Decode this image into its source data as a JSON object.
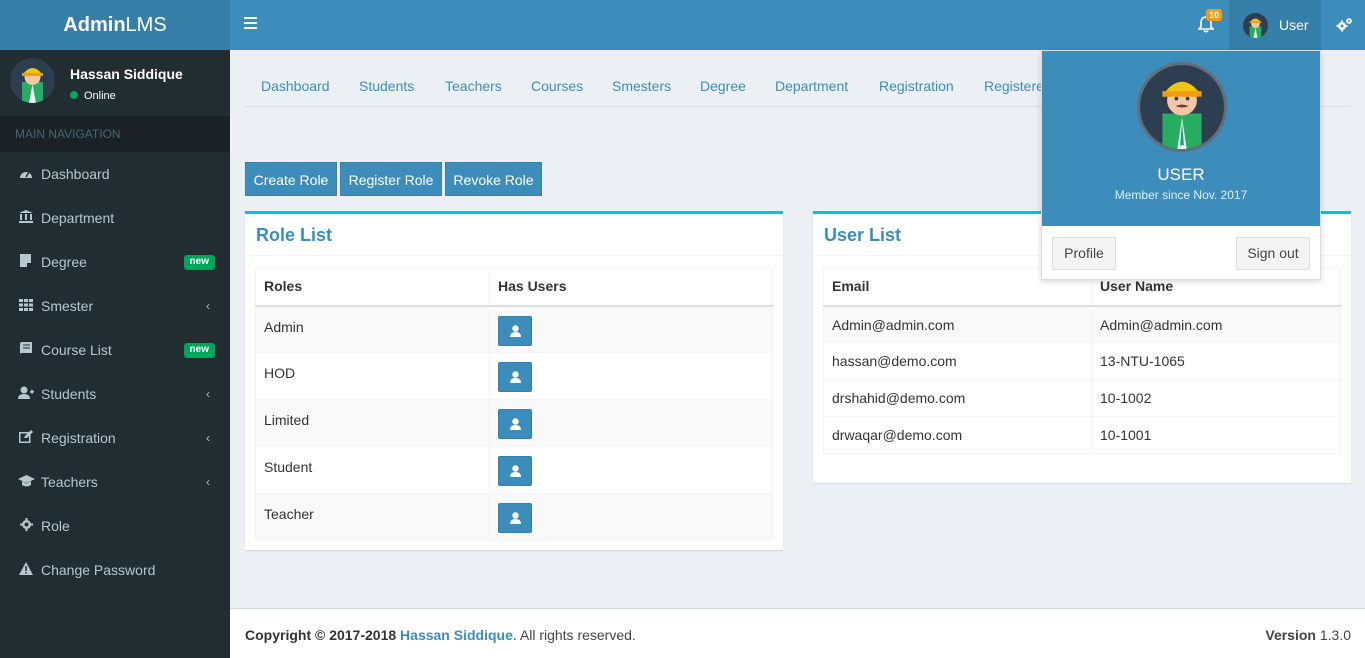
{
  "logo": {
    "bold": "Admin",
    "rest": "LMS"
  },
  "user_panel": {
    "name": "Hassan Siddique",
    "status": "Online"
  },
  "nav_header": "MAIN NAVIGATION",
  "sidebar": {
    "items": [
      {
        "label": "Dashboard",
        "icon": "dashboard-icon"
      },
      {
        "label": "Department",
        "icon": "bank-icon"
      },
      {
        "label": "Degree",
        "icon": "book-icon",
        "badge": "new"
      },
      {
        "label": "Smester",
        "icon": "grid-icon",
        "chevron": "‹"
      },
      {
        "label": "Course List",
        "icon": "book-icon",
        "badge": "new"
      },
      {
        "label": "Students",
        "icon": "user-plus-icon",
        "chevron": "‹"
      },
      {
        "label": "Registration",
        "icon": "edit-icon",
        "chevron": "‹"
      },
      {
        "label": "Teachers",
        "icon": "graduation-cap-icon",
        "chevron": "‹"
      },
      {
        "label": "Role",
        "icon": "gear-icon"
      },
      {
        "label": "Change Password",
        "icon": "warning-icon"
      }
    ]
  },
  "topbar": {
    "notifications_count": "10",
    "user_label": "User"
  },
  "tabs": [
    "Dashboard",
    "Students",
    "Teachers",
    "Courses",
    "Smesters",
    "Degree",
    "Department",
    "Registration",
    "Registered"
  ],
  "buttons": {
    "create_role": "Create Role",
    "register_role": "Register Role",
    "revoke_role": "Revoke Role"
  },
  "role_list": {
    "title": "Role List",
    "headers": [
      "Roles",
      "Has Users"
    ],
    "rows": [
      "Admin",
      "HOD",
      "Limited",
      "Student",
      "Teacher"
    ]
  },
  "user_list": {
    "title": "User List",
    "headers": [
      "Email",
      "User Name"
    ],
    "rows": [
      {
        "email": "Admin@admin.com",
        "username": "Admin@admin.com"
      },
      {
        "email": "hassan@demo.com",
        "username": "13-NTU-1065"
      },
      {
        "email": "drshahid@demo.com",
        "username": "10-1002"
      },
      {
        "email": "drwaqar@demo.com",
        "username": "10-1001"
      }
    ]
  },
  "dropdown": {
    "name": "USER",
    "since": "Member since Nov. 2017",
    "profile": "Profile",
    "signout": "Sign out"
  },
  "footer": {
    "copyright": "Copyright © 2017-2018 ",
    "author": "Hassan Siddique",
    "rights": ". All rights reserved.",
    "version_label": "Version",
    "version": " 1.3.0"
  },
  "colors": {
    "primary": "#3c8dbc",
    "sidebar_bg": "#222d32",
    "badge_green": "#00a65a",
    "box_top": "#00c0ef",
    "notif_badge": "#f39c12"
  }
}
